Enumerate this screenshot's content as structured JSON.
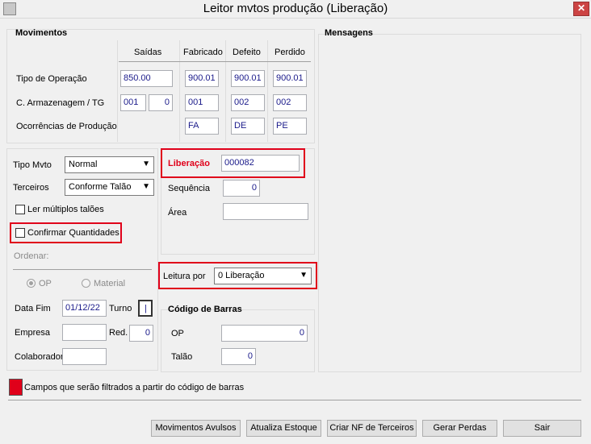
{
  "window": {
    "title": "Leitor mvtos produção (Liberação)",
    "close_glyph": "✕"
  },
  "movimentos": {
    "title": "Movimentos",
    "columns": {
      "saidas": "Saídas",
      "fabricado": "Fabricado",
      "defeito": "Defeito",
      "perdido": "Perdido"
    },
    "rows": {
      "tipo_operacao": {
        "label": "Tipo de Operação",
        "saidas": "850.00",
        "fabricado": "900.01",
        "defeito": "900.01",
        "perdido": "900.01"
      },
      "armazenagem": {
        "label": "C. Armazenagem / TG",
        "saidas_a": "001",
        "saidas_b": "0",
        "fabricado": "001",
        "defeito": "002",
        "perdido": "002"
      },
      "ocorrencias": {
        "label": "Ocorrências de Produção",
        "fabricado": "FA",
        "defeito": "DE",
        "perdido": "PE"
      }
    }
  },
  "mensagens": {
    "title": "Mensagens"
  },
  "form": {
    "tipo_mvto": {
      "label": "Tipo Mvto",
      "value": "Normal"
    },
    "terceiros": {
      "label": "Terceiros",
      "value": "Conforme Talão"
    },
    "ler_multiplos": {
      "label": "Ler múltiplos talões"
    },
    "confirmar": {
      "label": "Confirmar Quantidades"
    },
    "ordenar": {
      "label": "Ordenar:",
      "op": "OP",
      "material": "Material"
    },
    "data_fim": {
      "label": "Data Fim",
      "value": "01/12/22"
    },
    "turno": {
      "label": "Turno",
      "value": "|"
    },
    "empresa": {
      "label": "Empresa",
      "value": ""
    },
    "red": {
      "label": "Red.",
      "value": "0"
    },
    "colaborador": {
      "label": "Colaborador",
      "value": ""
    }
  },
  "liberacao": {
    "label": "Liberação",
    "value": "000082",
    "sequencia": {
      "label": "Sequência",
      "value": "0"
    },
    "area": {
      "label": "Área",
      "value": ""
    }
  },
  "leitura": {
    "label": "Leitura por",
    "value": "0 Liberação"
  },
  "codigo_barras": {
    "title": "Código de Barras",
    "op": {
      "label": "OP",
      "value": "0"
    },
    "talao": {
      "label": "Talão",
      "value": "0"
    }
  },
  "legend": {
    "text": "Campos que serão filtrados a partir do código de barras",
    "color": "#e0001a"
  },
  "buttons": {
    "movimentos_avulsos": "Movimentos Avulsos",
    "atualiza_estoque": "Atualiza Estoque",
    "criar_nf": "Criar NF de Terceiros",
    "gerar_perdas": "Gerar Perdas",
    "sair": "Sair"
  },
  "colors": {
    "highlight": "#e0001a",
    "value_text": "#1a1a8a"
  }
}
